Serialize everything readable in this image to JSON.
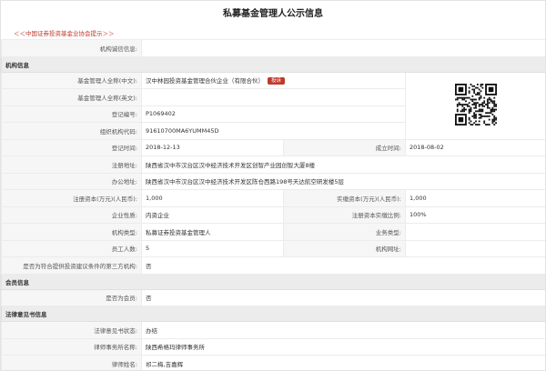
{
  "title": "私募基金管理人公示信息",
  "notice": "＜＜中国证券投资基金业协会提示＞＞",
  "fields": {
    "integrity_label": "机构诚信信息:",
    "integrity_value": "",
    "sec_org": "机构信息",
    "name_cn_label": "基金管理人全称(中文):",
    "name_cn_value": "汉中林园投资基金管理合伙企业（有限合伙）",
    "name_cn_badge": "投诉",
    "name_en_label": "基金管理人全称(英文):",
    "name_en_value": "",
    "reg_no_label": "登记编号:",
    "reg_no_value": "P1069402",
    "org_code_label": "组织机构代码:",
    "org_code_value": "91610700MA6YUMM45D",
    "reg_time_label": "登记时间:",
    "reg_time_value": "2018-12-13",
    "est_time_label": "成立时间:",
    "est_time_value": "2018-08-02",
    "reg_addr_label": "注册地址:",
    "reg_addr_value": "陕西省汉中市汉台区汉中经济技术开发区创智产业园创智大厦8楼",
    "office_addr_label": "办公地址:",
    "office_addr_value": "陕西省汉中市汉台区汉中经济技术开发区陈仓西路198号天达航空研发楼5层",
    "reg_cap_label": "注册资本(万元)(人民币):",
    "reg_cap_value": "1,000",
    "paid_cap_label": "实缴资本(万元)(人民币):",
    "paid_cap_value": "1,000",
    "nature_label": "企业性质:",
    "nature_value": "内资企业",
    "ratio_label": "注册资本实缴比例:",
    "ratio_value": "100%",
    "type_label": "机构类型:",
    "type_value": "私募证券投资基金管理人",
    "biz_type_label": "业务类型:",
    "biz_type_value": "",
    "staff_label": "员工人数:",
    "staff_value": "5",
    "site_label": "机构网址:",
    "site_value": "",
    "third_party_label": "是否为符合提供投资建议条件的第三方机构:",
    "third_party_value": "否",
    "sec_member": "会员信息",
    "member_label": "是否为会员:",
    "member_value": "否",
    "sec_legal": "法律意见书信息",
    "legal_status_label": "法律意见书状态:",
    "legal_status_value": "办结",
    "law_firm_label": "律师事务所名称:",
    "law_firm_value": "陕西希格玛律师事务所",
    "lawyer_label": "律师姓名:",
    "lawyer_value": "祁二梅,吉嘉辉"
  }
}
